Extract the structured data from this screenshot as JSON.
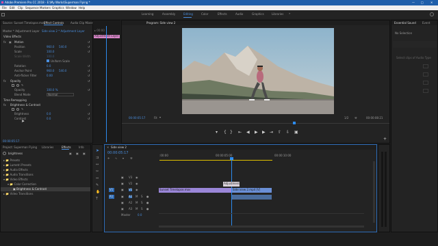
{
  "window": {
    "title": "Adobe Premiere Pro CC 2018 - E:\\My Works\\Superman Flying *"
  },
  "menu": [
    "File",
    "Edit",
    "Clip",
    "Sequence",
    "Markers",
    "Graphics",
    "Window",
    "Help"
  ],
  "workspaces": [
    "Learning",
    "Assembly",
    "Editing",
    "Color",
    "Effects",
    "Audio",
    "Graphics",
    "Libraries"
  ],
  "active_workspace": "Editing",
  "source_panel": {
    "tabs": [
      "Source: Sunset Timelapse.mov",
      "Effect Controls",
      "Audio Clip Mixer: Side view 2"
    ],
    "active_tab": "Effect Controls",
    "master": "Master * Adjustment Layer",
    "sequence": "Side view 2 * Adjustment Layer",
    "clip_label": "Adjustment Layer",
    "video_effects": "Video Effects",
    "motion": "Motion",
    "position": "Position",
    "position_x": "960.0",
    "position_y": "540.0",
    "scale": "Scale",
    "scale_val": "100.0",
    "scale_width": "Scale Width",
    "scale_width_val": "100.0",
    "uniform_scale": "Uniform Scale",
    "rotation": "Rotation",
    "rotation_val": "0.0",
    "anchor": "Anchor Point",
    "anchor_x": "960.0",
    "anchor_y": "540.0",
    "flicker": "Anti-flicker Filter",
    "flicker_val": "0.00",
    "opacity_group": "Opacity",
    "opacity": "Opacity",
    "opacity_val": "100.0 %",
    "blend": "Blend Mode",
    "blend_val": "Normal",
    "time_remap": "Time Remapping",
    "bc": "Brightness & Contrast",
    "brightness": "Brightness",
    "brightness_val": "0.0",
    "contrast": "Contrast",
    "contrast_val": "0.0",
    "timecode": "00:00:05:17"
  },
  "program": {
    "title": "Program: Side view 2",
    "timecode": "00:00:05:17",
    "fit": "Fit",
    "quality": "1/2",
    "duration": "00:00:08:21"
  },
  "essential_sound": {
    "tabs": [
      "Essential Sound",
      "Event"
    ],
    "no_selection": "No Selection",
    "hint": "Select clips of Audio Type"
  },
  "effects_panel": {
    "tabs": [
      "Project: Superman Flying",
      "Libraries",
      "Effects",
      "Info"
    ],
    "active_tab": "Effects",
    "search": "brightness",
    "items": [
      "Presets",
      "Lumetri Presets",
      "Audio Effects",
      "Audio Transitions",
      "Video Effects",
      "Color Correction",
      "Brightness & Contrast",
      "Video Transitions"
    ]
  },
  "timeline": {
    "title": "Side view 2",
    "timecode": "00:00:05:17",
    "ruler": [
      ":00:00",
      "00:00:05:00",
      "00:00:10:00"
    ],
    "video_tracks": [
      "V3",
      "V2",
      "V1"
    ],
    "audio_tracks": [
      "A1",
      "A2",
      "A3"
    ],
    "master": "Master",
    "master_val": "0.0",
    "clip_v1a": "Sunset Timelapse.mov",
    "clip_v1b": "Side view 2.mp4 [V]",
    "clip_v2": "Adjustment"
  },
  "colors": {
    "accent": "#4a8fe0",
    "playhead": "#2d8cf0",
    "adjustment": "#d884c8",
    "video_clip": "#9a86d8",
    "video_clip2": "#6a8fd6",
    "work_area": "#e0c000",
    "title_bar": "#1f5faa"
  }
}
